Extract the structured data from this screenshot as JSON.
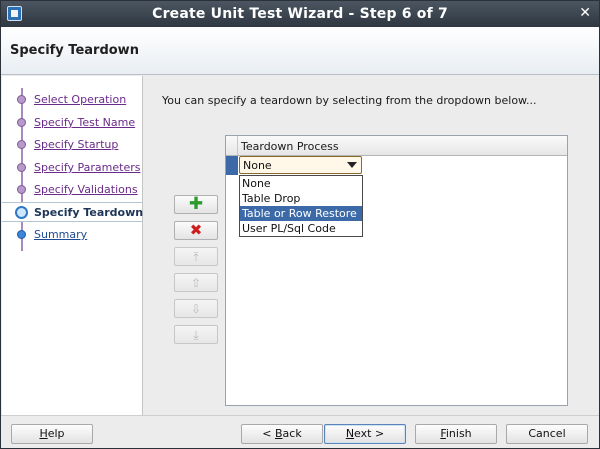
{
  "window": {
    "title": "Create Unit Test Wizard - Step 6 of 7"
  },
  "header": {
    "title": "Specify Teardown"
  },
  "sidebar": {
    "steps": [
      {
        "label": "Select Operation",
        "state": "visited"
      },
      {
        "label": "Specify Test Name",
        "state": "visited"
      },
      {
        "label": "Specify Startup",
        "state": "visited"
      },
      {
        "label": "Specify Parameters",
        "state": "visited"
      },
      {
        "label": "Specify Validations",
        "state": "visited"
      },
      {
        "label": "Specify Teardown",
        "state": "current"
      },
      {
        "label": "Summary",
        "state": "future"
      }
    ]
  },
  "main": {
    "instruction": "You can specify a teardown by selecting from the dropdown below...",
    "toolbar": {
      "add_icon": "add-icon",
      "remove_icon": "remove-icon",
      "move_top_icon": "move-top-icon",
      "move_up_icon": "move-up-icon",
      "move_down_icon": "move-down-icon",
      "move_bottom_icon": "move-bottom-icon"
    },
    "table": {
      "column_header": "Teardown Process",
      "combo_value": "None",
      "options": [
        "None",
        "Table Drop",
        "Table or Row Restore",
        "User PL/Sql Code"
      ],
      "highlighted_option": "Table or Row Restore"
    }
  },
  "footer": {
    "help": {
      "mnemonic": "H",
      "rest": "elp"
    },
    "back": {
      "prefix": "< ",
      "mnemonic": "B",
      "rest": "ack"
    },
    "next": {
      "mnemonic": "N",
      "rest": "ext >"
    },
    "finish": {
      "mnemonic": "F",
      "rest": "inish"
    },
    "cancel": {
      "label": "Cancel"
    }
  },
  "colors": {
    "accent": "#3c6aa8",
    "visited_link": "#6a2a8a",
    "titlebar": "#2f3740"
  }
}
